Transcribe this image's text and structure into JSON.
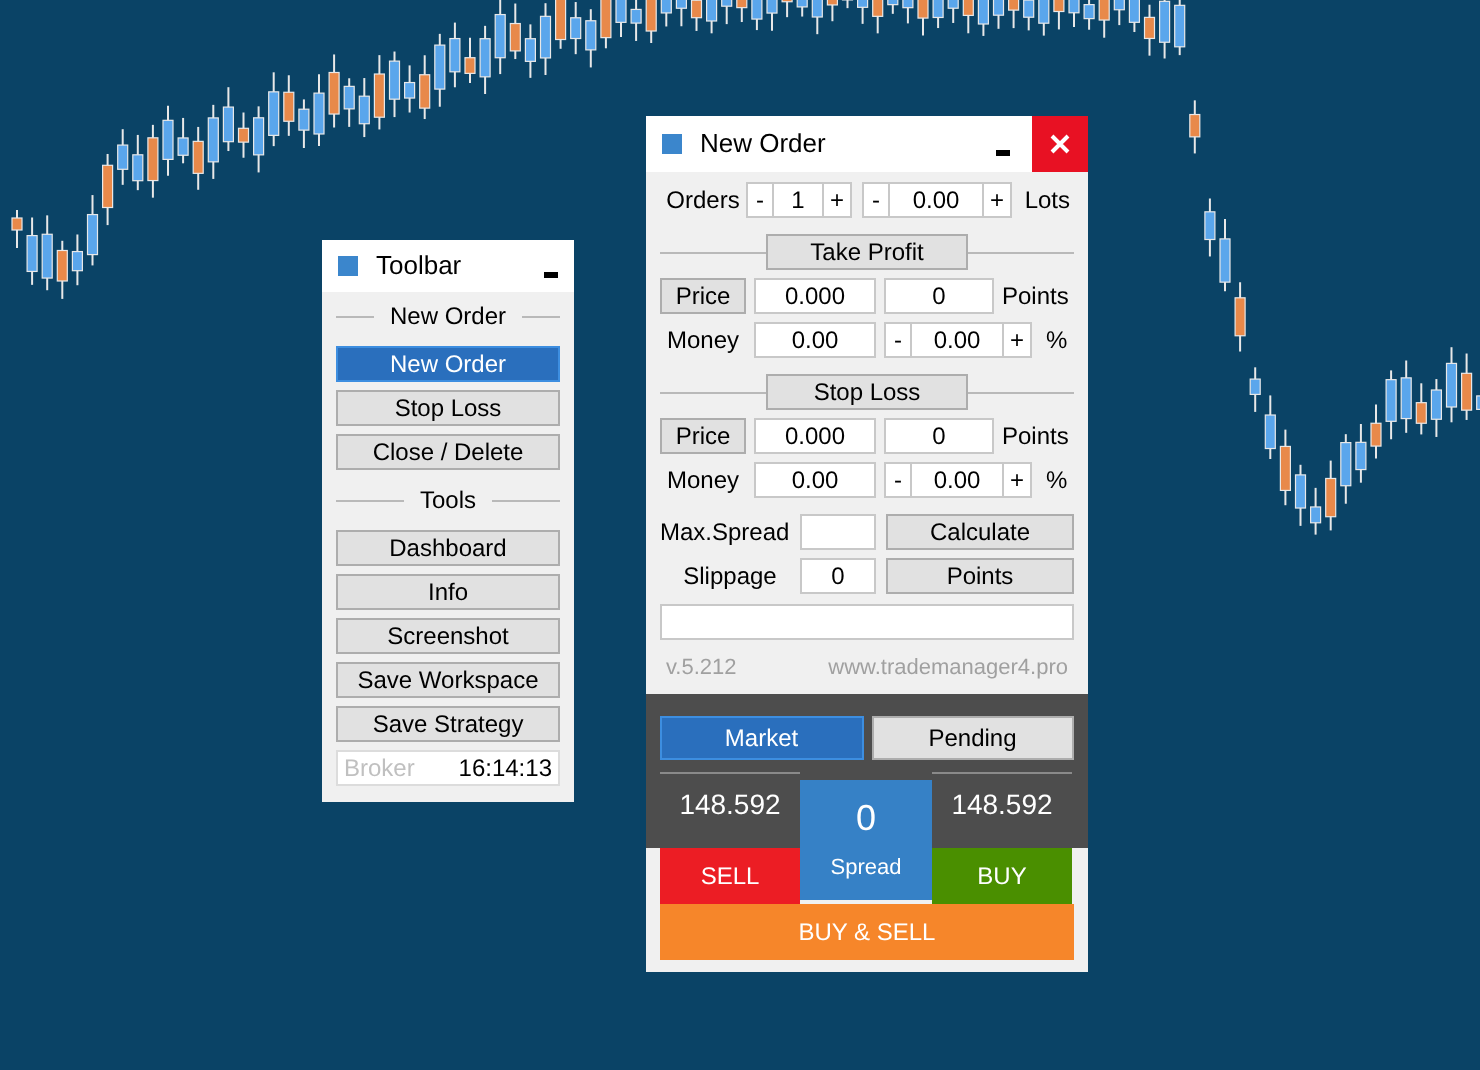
{
  "toolbar": {
    "title": "Toolbar",
    "sections": [
      {
        "heading": "New Order",
        "buttons": [
          {
            "label": "New Order",
            "selected": true
          },
          {
            "label": "Stop Loss",
            "selected": false
          },
          {
            "label": "Close / Delete",
            "selected": false
          }
        ]
      },
      {
        "heading": "Tools",
        "buttons": [
          {
            "label": "Dashboard",
            "selected": false
          },
          {
            "label": "Info",
            "selected": false
          },
          {
            "label": "Screenshot",
            "selected": false
          },
          {
            "label": "Save Workspace",
            "selected": false
          },
          {
            "label": "Save Strategy",
            "selected": false
          }
        ]
      }
    ],
    "broker": {
      "label": "Broker",
      "time": "16:14:13"
    }
  },
  "new_order": {
    "title": "New Order",
    "orders": {
      "label": "Orders",
      "minus": "-",
      "value": "1",
      "plus": "+"
    },
    "lots": {
      "minus": "-",
      "value": "0.00",
      "plus": "+",
      "label": "Lots"
    },
    "sections": [
      {
        "heading": "Take Profit",
        "price_button": "Price",
        "price": "0.000",
        "points": "0",
        "points_label": "Points",
        "money_label": "Money",
        "money": "0.00",
        "minus": "-",
        "percent": "0.00",
        "plus": "+",
        "percent_label": "%"
      },
      {
        "heading": "Stop Loss",
        "price_button": "Price",
        "price": "0.000",
        "points": "0",
        "points_label": "Points",
        "money_label": "Money",
        "money": "0.00",
        "minus": "-",
        "percent": "0.00",
        "plus": "+",
        "percent_label": "%"
      }
    ],
    "max_spread": {
      "label": "Max.Spread",
      "button": "Calculate"
    },
    "slippage": {
      "label": "Slippage",
      "value": "0",
      "button": "Points"
    },
    "version": "v.5.212",
    "website": "www.trademanager4.pro",
    "mode_tabs": [
      {
        "label": "Market",
        "selected": true
      },
      {
        "label": "Pending",
        "selected": false
      }
    ],
    "bid": "148.592",
    "spread": "0",
    "spread_label": "Spread",
    "ask": "148.592",
    "sell": "SELL",
    "buy": "BUY",
    "buy_and_sell": "BUY & SELL"
  }
}
